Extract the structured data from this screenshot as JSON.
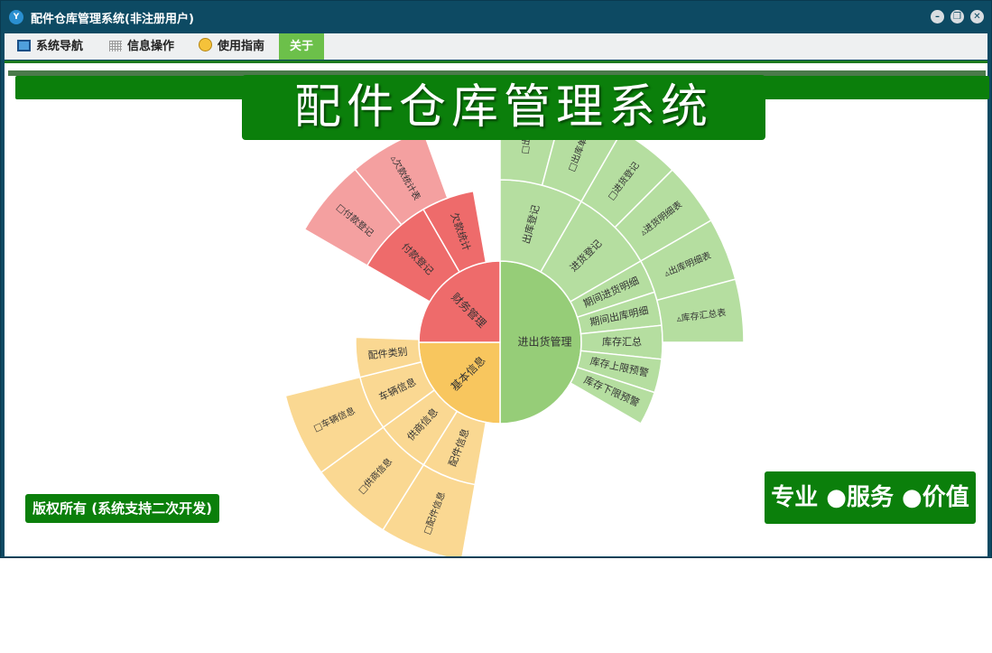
{
  "window": {
    "title": "配件仓库管理系统(非注册用户)",
    "app_icon": "Y"
  },
  "menu": [
    {
      "label": "系统导航",
      "icon": "monitor-icon"
    },
    {
      "label": "信息操作",
      "icon": "grid-icon"
    },
    {
      "label": "使用指南",
      "icon": "bulb-icon"
    },
    {
      "label": "关于",
      "icon": ""
    }
  ],
  "banner": {
    "title": "配件仓库管理系统"
  },
  "footer": {
    "copyright": "版权所有 (系统支持二次开发)",
    "slogan": "专业 ●服务 ●价值"
  },
  "colors": {
    "titlebar": "#0d4a63",
    "green": "#0b7f0b",
    "inout": "#96cd78",
    "inout_light": "#b5dea0",
    "finance": "#ee6b6b",
    "finance_light": "#f4a0a0",
    "base": "#f8c65e",
    "base_light": "#fad892"
  },
  "sunburst": {
    "inner": [
      {
        "label": "进出货管理",
        "value": 0.5
      },
      {
        "label": "基本信息",
        "value": 0.25
      },
      {
        "label": "财务管理",
        "value": 0.25
      }
    ],
    "middle": [
      {
        "label": "出库登记"
      },
      {
        "label": "进货登记"
      },
      {
        "label": "期间进货明细"
      },
      {
        "label": "期间出库明细"
      },
      {
        "label": "库存汇总"
      },
      {
        "label": "库存上限预警"
      },
      {
        "label": "库存下限预警"
      },
      {
        "label": "配件信息"
      },
      {
        "label": "供商信息"
      },
      {
        "label": "车辆信息"
      },
      {
        "label": "配件类别"
      },
      {
        "label": "付款登记"
      },
      {
        "label": "欠款统计"
      }
    ],
    "outer": [
      {
        "label": "□出库"
      },
      {
        "label": "□出库单"
      },
      {
        "label": "□进货登记"
      },
      {
        "label": "▵进货明细表"
      },
      {
        "label": "▵出库明细表"
      },
      {
        "label": "▵库存汇总表"
      },
      {
        "label": "□配件信息"
      },
      {
        "label": "□供商信息"
      },
      {
        "label": "□车辆信息"
      },
      {
        "label": "□付款登记"
      },
      {
        "label": "▵欠款统计表"
      }
    ]
  }
}
